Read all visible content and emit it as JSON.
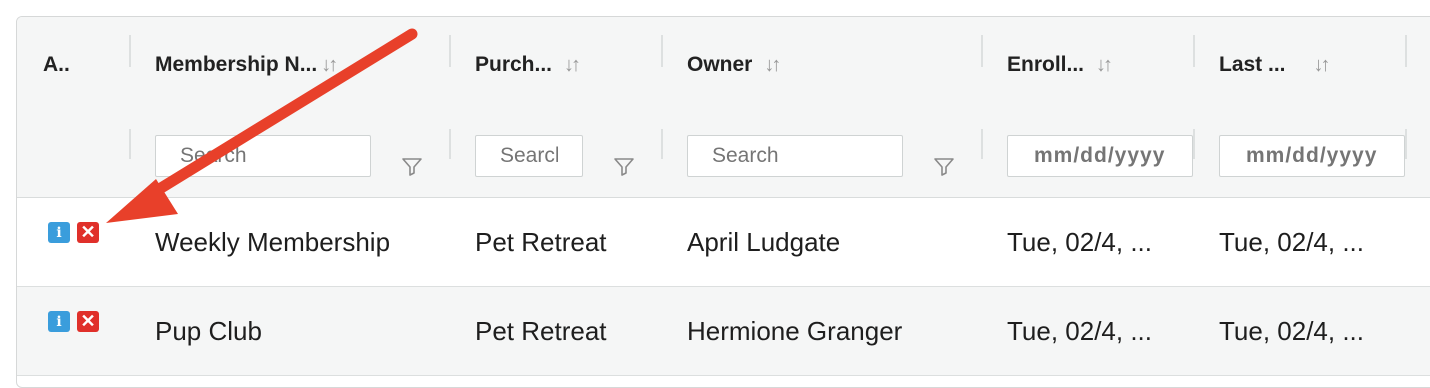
{
  "columns": [
    {
      "label": "A.."
    },
    {
      "label": "Membership N...",
      "sort": "↓↑"
    },
    {
      "label": "Purch...",
      "sort": "↓↑"
    },
    {
      "label": "Owner",
      "sort": "↓↑"
    },
    {
      "label": "Enroll...",
      "sort": "↓↑"
    },
    {
      "label": "Last ...",
      "sort": "↓↑"
    }
  ],
  "filters": {
    "membership_placeholder": "Search",
    "purchase_placeholder": "Search",
    "owner_placeholder": "Search",
    "enroll_placeholder": "mm/dd/yyyy",
    "last_placeholder": "mm/dd/yyyy"
  },
  "rows": [
    {
      "membership": "Weekly Membership",
      "purchase": "Pet Retreat",
      "owner": "April Ludgate",
      "enrolled": "Tue, 02/4, ...",
      "last": "Tue, 02/4, ..."
    },
    {
      "membership": "Pup Club",
      "purchase": "Pet Retreat",
      "owner": "Hermione Granger",
      "enrolled": "Tue, 02/4, ...",
      "last": "Tue, 02/4, ..."
    }
  ],
  "actions": {
    "info_glyph": "i",
    "delete_glyph": "✕"
  },
  "colors": {
    "annotation_arrow": "#e8402a",
    "info_button": "#3a9ddc",
    "delete_button": "#e0302a"
  }
}
